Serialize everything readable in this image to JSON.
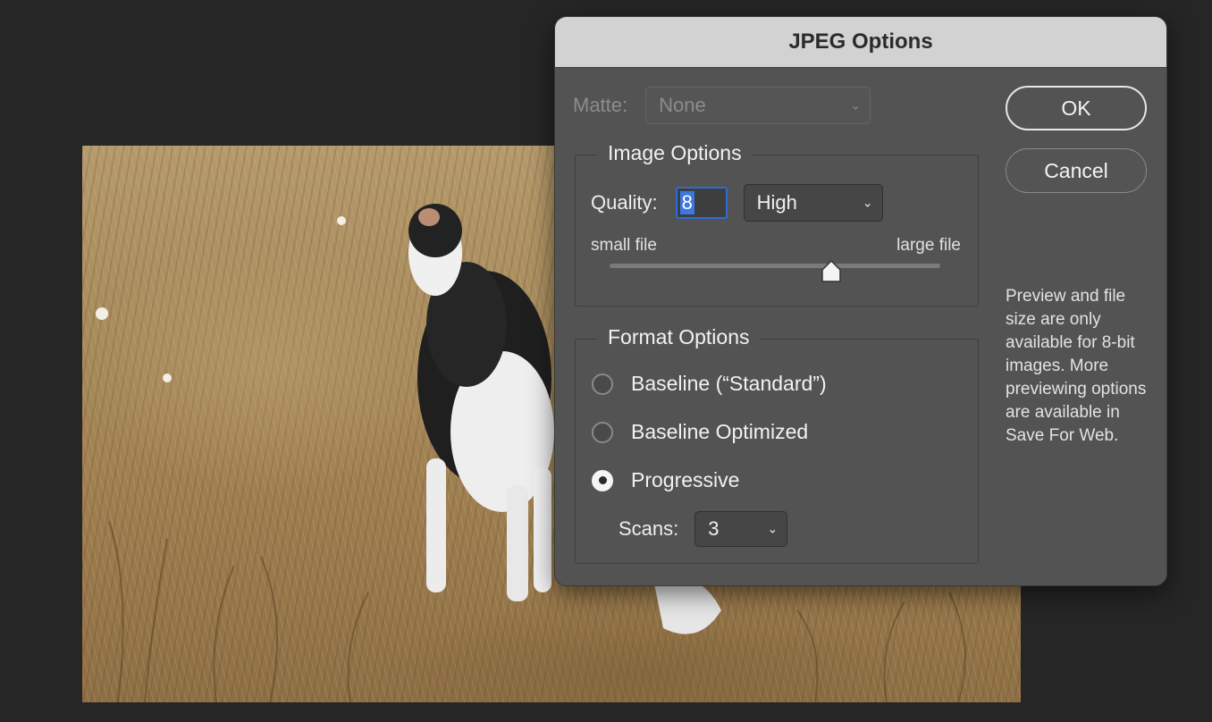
{
  "dialog": {
    "title": "JPEG Options",
    "matte": {
      "label": "Matte:",
      "value": "None"
    },
    "image_options": {
      "heading": "Image Options",
      "quality_label": "Quality:",
      "quality_value": "8",
      "quality_preset": "High",
      "small_file_label": "small file",
      "large_file_label": "large file",
      "slider_fraction": 0.67
    },
    "format_options": {
      "heading": "Format Options",
      "baseline_standard": "Baseline (“Standard”)",
      "baseline_optimized": "Baseline Optimized",
      "progressive": "Progressive",
      "selected": "Progressive",
      "scans_label": "Scans:",
      "scans_value": "3"
    },
    "ok_label": "OK",
    "cancel_label": "Cancel",
    "info_text": "Preview and file size are only available for 8-bit images. More previewing options are available in Save For Web."
  }
}
